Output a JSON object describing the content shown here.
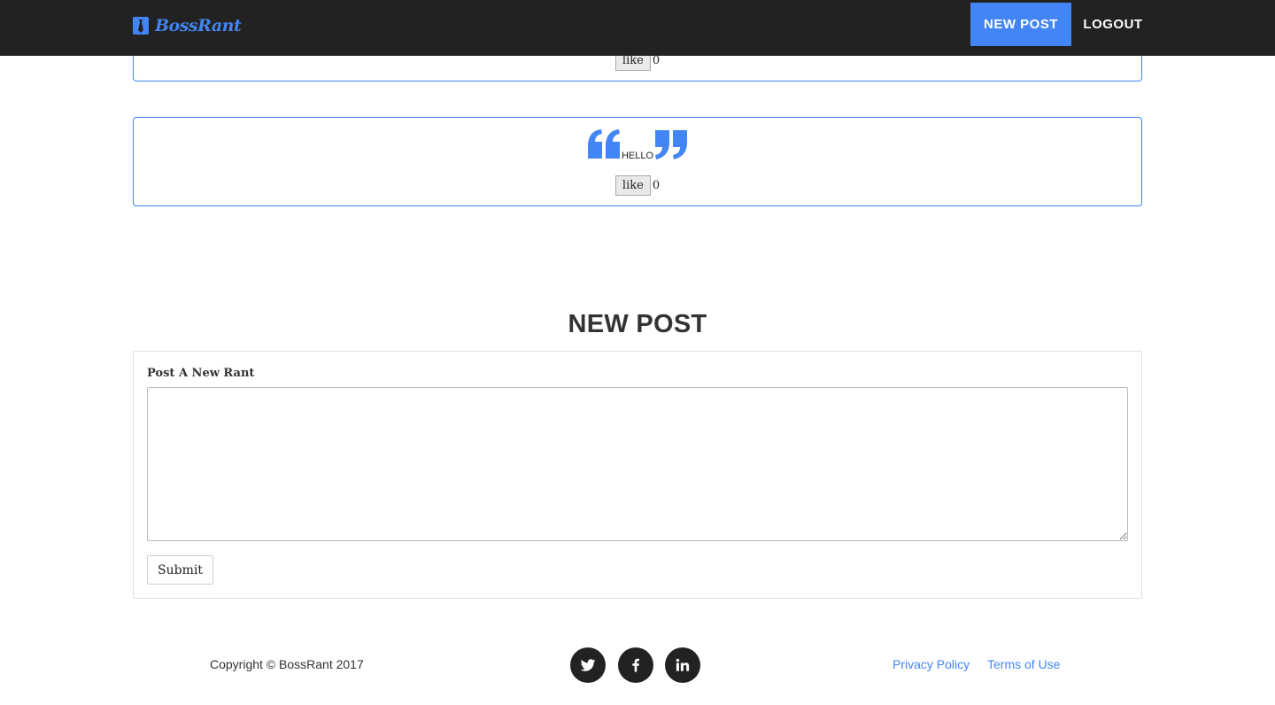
{
  "navbar": {
    "brand": "BossRant",
    "brand_icon": "tie-icon",
    "new_post_label": "NEW POST",
    "logout_label": "LOGOUT"
  },
  "posts": [
    {
      "text": "",
      "like_label": "like",
      "likes": "0"
    },
    {
      "text": "HELLO",
      "like_label": "like",
      "likes": "0"
    }
  ],
  "new_post": {
    "heading": "NEW POST",
    "field_label": "Post A New Rant",
    "textarea_value": "",
    "submit_label": "Submit"
  },
  "footer": {
    "copyright": "Copyright © BossRant 2017",
    "social": [
      "twitter-icon",
      "facebook-icon",
      "linkedin-icon"
    ],
    "privacy_label": "Privacy Policy",
    "terms_label": "Terms of Use"
  },
  "colors": {
    "accent": "#4285f4",
    "navbar": "#222222"
  }
}
